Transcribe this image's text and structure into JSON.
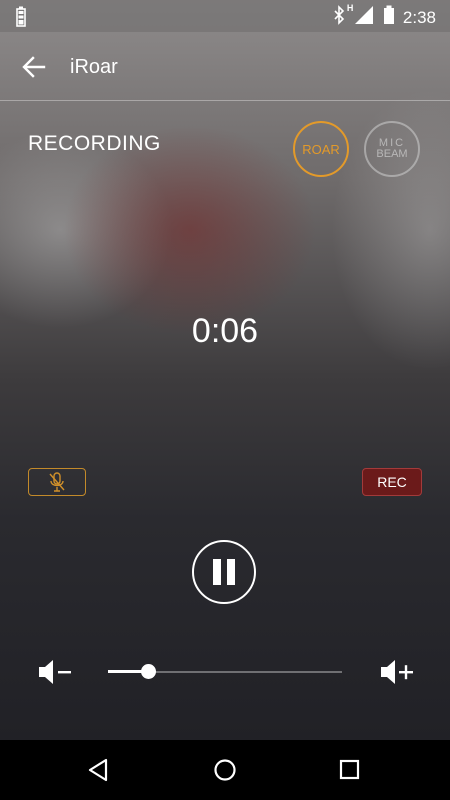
{
  "status_bar": {
    "time": "2:38",
    "network_label": "H",
    "icons": [
      "battery-charging-icon",
      "bluetooth-icon",
      "signal-icon",
      "battery-icon"
    ]
  },
  "toolbar": {
    "title": "iRoar",
    "back_icon": "arrow-left-icon"
  },
  "main": {
    "mode_label": "RECORDING",
    "mode_buttons": [
      {
        "label": "ROAR",
        "active": true,
        "color": "#e39a2a"
      },
      {
        "label_line1": "MIC",
        "label_line2": "BEAM",
        "active": false
      }
    ],
    "timer": "0:06",
    "mute_icon": "mic-off-icon",
    "rec_label": "REC",
    "pause_icon": "pause-icon"
  },
  "volume": {
    "down_icon": "volume-down-icon",
    "up_icon": "volume-up-icon",
    "level": 0.17
  },
  "nav": {
    "icons": [
      "back-triangle-icon",
      "home-circle-icon",
      "recents-square-icon"
    ]
  }
}
